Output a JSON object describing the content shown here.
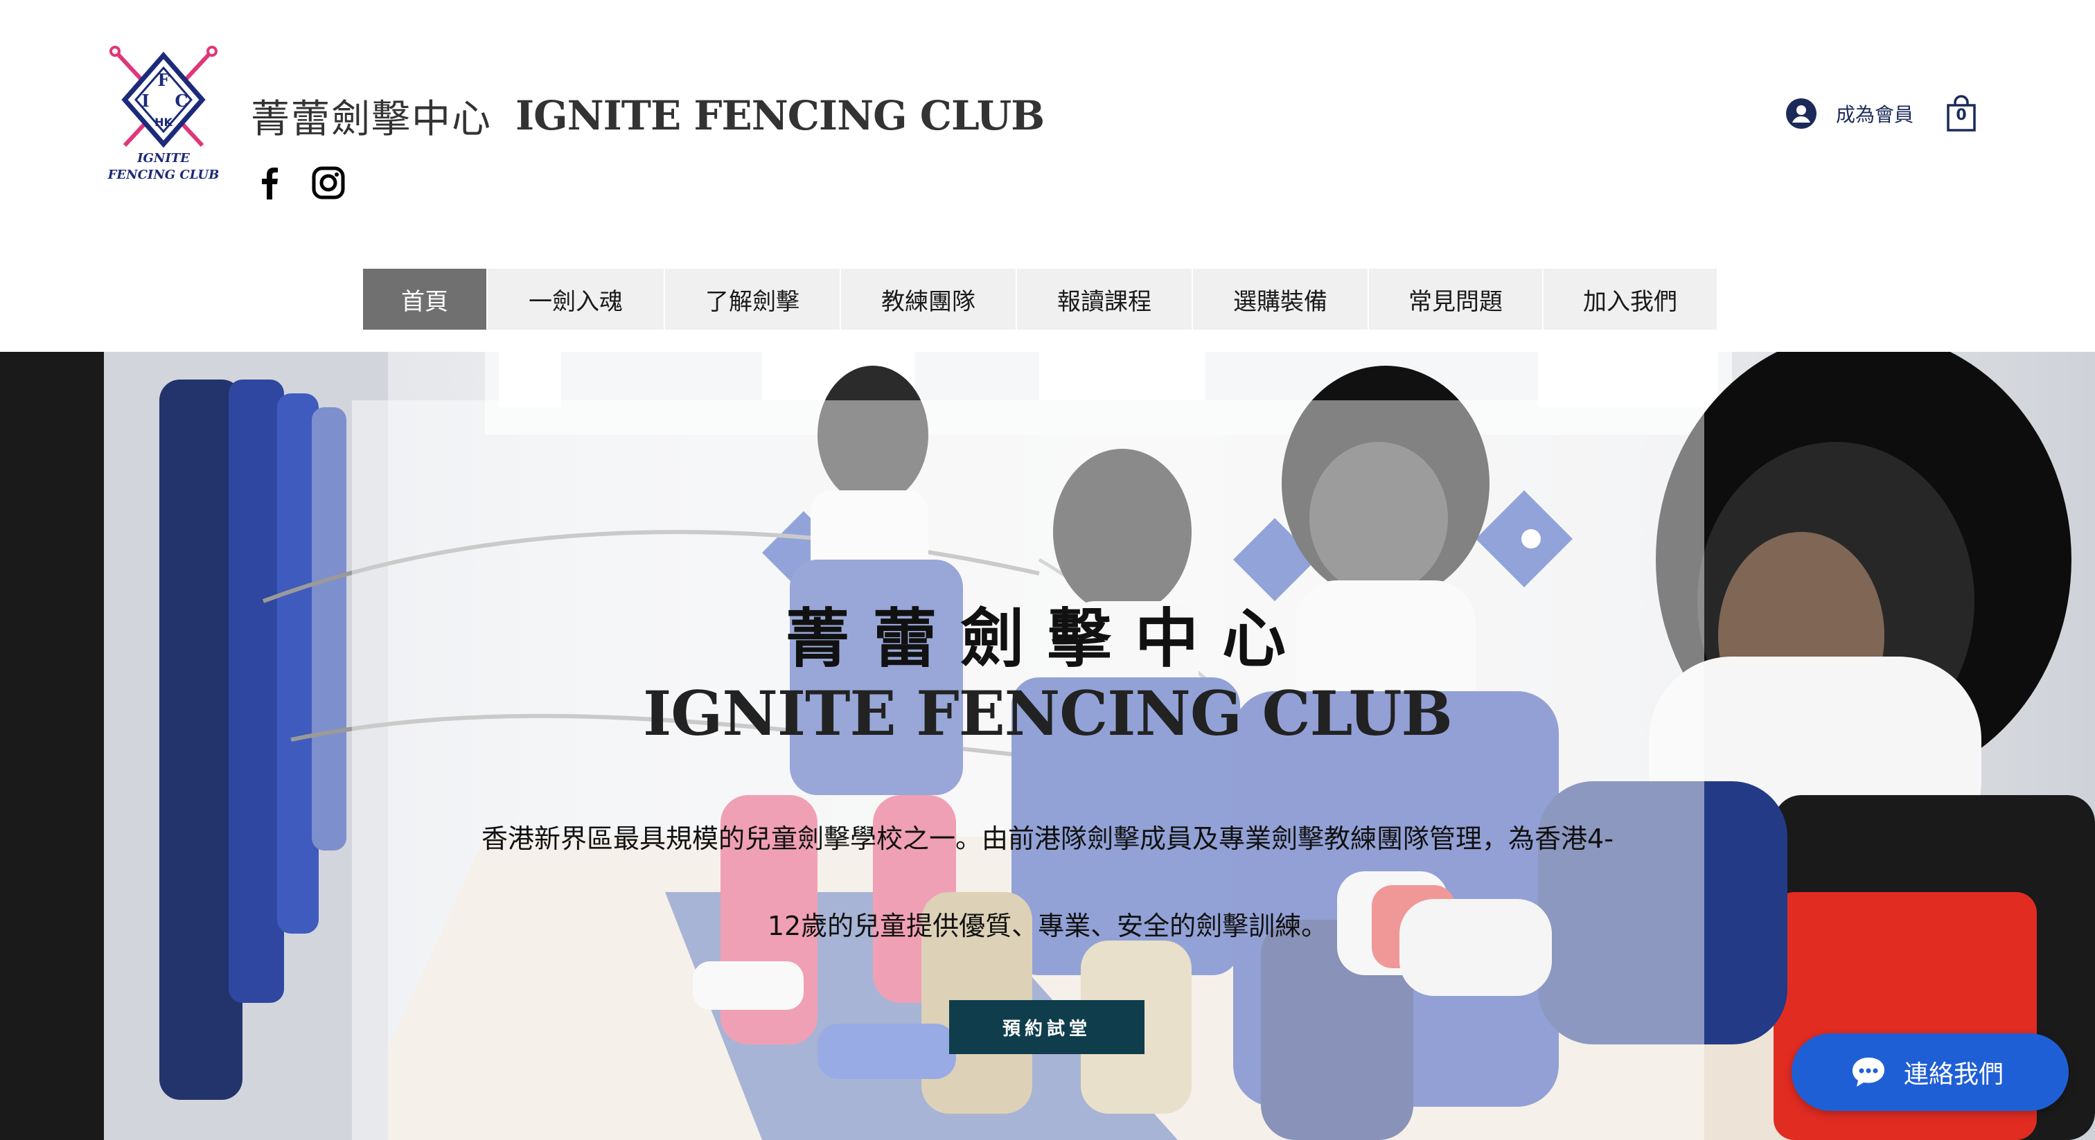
{
  "header": {
    "logo": {
      "letters": [
        "I",
        "F",
        "C"
      ],
      "badge": "HK",
      "text_line1": "IGNITE",
      "text_line2": "FENCING CLUB"
    },
    "title_zh": "菁蕾劍擊中心",
    "title_en": "IGNITE FENCING CLUB",
    "social": [
      {
        "icon": "facebook-icon"
      },
      {
        "icon": "instagram-icon"
      }
    ],
    "member_label": "成為會員",
    "cart_count": "0"
  },
  "nav": {
    "items": [
      {
        "label": "首頁",
        "active": true
      },
      {
        "label": "一劍入魂"
      },
      {
        "label": "了解劍擊"
      },
      {
        "label": "教練團隊"
      },
      {
        "label": "報讀課程"
      },
      {
        "label": "選購裝備"
      },
      {
        "label": "常見問題"
      },
      {
        "label": "加入我們"
      }
    ]
  },
  "hero": {
    "title_zh": "菁蕾劍擊中心",
    "title_en": "IGNITE FENCING CLUB",
    "desc_line1": "香港新界區最具規模的兒童劍擊學校之一。由前港隊劍擊成員及專業劍擊教練團隊管理，為香港4-",
    "desc_line2": "12歲的兒童提供優質、專業、安全的劍擊訓練。",
    "cta_label": "預約試堂"
  },
  "chat": {
    "label": "連絡我們",
    "icon": "chat-bubble-icon"
  },
  "colors": {
    "nav_active_bg": "#707070",
    "nav_bg": "#f0f0f0",
    "cta_bg": "#0f3d4c",
    "chat_bg": "#1f5fd6",
    "logo_pink": "#e0367a",
    "logo_navy": "#1c2a7a"
  }
}
